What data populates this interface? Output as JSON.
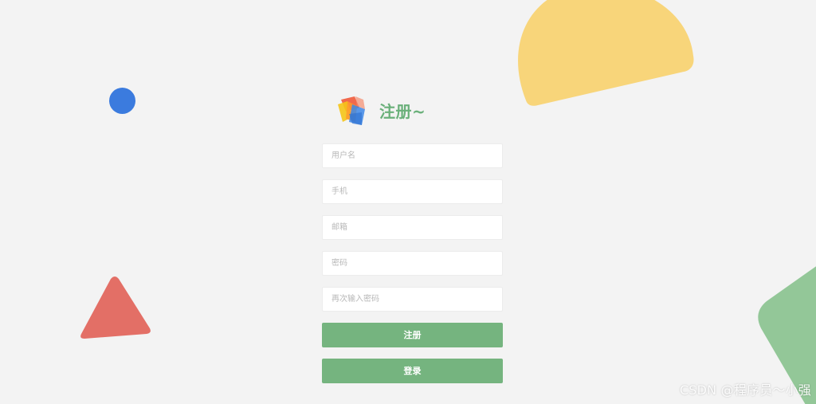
{
  "header": {
    "logo_icon": "cube-logo-icon",
    "title": "注册~"
  },
  "form": {
    "username_placeholder": "用户名",
    "phone_placeholder": "手机",
    "email_placeholder": "邮箱",
    "password_placeholder": "密码",
    "confirm_password_placeholder": "再次输入密码",
    "register_label": "注册",
    "login_label": "登录"
  },
  "watermark": "CSDN @程序员～小强",
  "colors": {
    "background": "#f3f3f3",
    "accent_green": "#75b47f",
    "title_green": "#6ab07a",
    "yellow": "#f8d57a",
    "blue": "#3b7bde",
    "red": "#e36f66",
    "green_shape": "#93c798"
  }
}
